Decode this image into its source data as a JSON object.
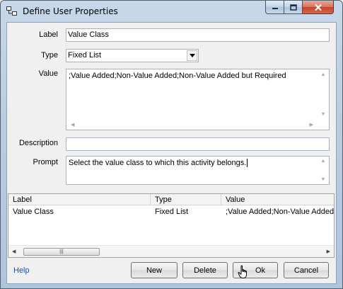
{
  "window": {
    "title": "Define User Properties",
    "icons": {
      "app": "user-properties-icon",
      "minimize": "minimize-icon",
      "maximize": "maximize-icon",
      "close": "close-icon"
    }
  },
  "form": {
    "label_caption": "Label",
    "label_value": "Value Class",
    "type_caption": "Type",
    "type_value": "Fixed List",
    "value_caption": "Value",
    "value_text": ";Value Added;Non-Value Added;Non-Value Added but Required",
    "description_caption": "Description",
    "description_value": "",
    "prompt_caption": "Prompt",
    "prompt_value": "Select the value class to which this activity belongs."
  },
  "grid": {
    "columns": [
      "Label",
      "Type",
      "Value"
    ],
    "rows": [
      {
        "label": "Value Class",
        "type": "Fixed List",
        "value": ";Value Added;Non-Value Added;"
      }
    ]
  },
  "footer": {
    "help": "Help",
    "new": "New",
    "delete": "Delete",
    "ok": "Ok",
    "cancel": "Cancel"
  }
}
